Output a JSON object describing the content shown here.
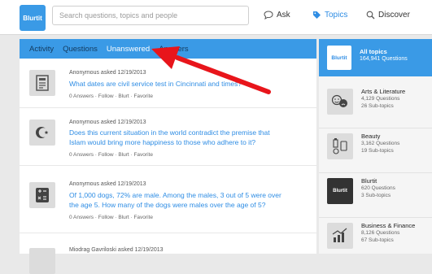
{
  "header": {
    "logo_text": "Blurtit",
    "search_placeholder": "Search questions, topics and people",
    "nav": [
      {
        "label": "Ask",
        "icon": "speech-bubble-icon"
      },
      {
        "label": "Topics",
        "icon": "tag-icon"
      },
      {
        "label": "Discover",
        "icon": "magnifier-icon"
      }
    ]
  },
  "tabs": [
    "Activity",
    "Questions",
    "Unanswered",
    "Answers"
  ],
  "active_tab": "Unanswered",
  "questions": [
    {
      "asker": "Anonymous",
      "asked": "asked 12/19/2013",
      "title_lines": [
        "What dates are civil service test in Cincinnati and times?"
      ],
      "icon": "document-icon",
      "actions": "0 Answers · Follow · Blurt · Favorite"
    },
    {
      "asker": "Anonymous",
      "asked": "asked 12/19/2013",
      "title_lines": [
        "Does this current situation in the world contradict the premise that",
        "Islam would bring more happiness to those who adhere to it?"
      ],
      "icon": "crescent-star-icon",
      "actions": "0 Answers · Follow · Blurt · Favorite"
    },
    {
      "asker": "Anonymous",
      "asked": "asked 12/19/2013",
      "title_lines": [
        "Of 1,000 dogs, 72% are male. Among the males, 3 out of 5 were over",
        "the age 5. How many of the dogs were males over the age of 5?"
      ],
      "icon": "calculator-icon",
      "actions": "0 Answers · Follow · Blurt · Favorite"
    },
    {
      "asker": "Miodrag Gavriloski",
      "asked": "asked 12/19/2013",
      "title_lines": [],
      "icon": "document-icon",
      "actions": ""
    }
  ],
  "sidebar": {
    "all_topics": {
      "title": "All topics",
      "count": "164,941 Questions",
      "thumb": "Blurtit"
    },
    "topics": [
      {
        "name": "Arts & Literature",
        "questions": "4,129 Questions",
        "subtopics": "26 Sub-topics",
        "icon": "theatre-masks-icon"
      },
      {
        "name": "Beauty",
        "questions": "3,162 Questions",
        "subtopics": "19 Sub-topics",
        "icon": "beauty-products-icon"
      },
      {
        "name": "Blurtit",
        "questions": "620 Questions",
        "subtopics": "3 Sub-topics",
        "icon": "blurtit-logo-icon"
      },
      {
        "name": "Business & Finance",
        "questions": "8,126 Questions",
        "subtopics": "67 Sub-topics",
        "icon": "finance-chart-icon"
      }
    ]
  },
  "colors": {
    "accent": "#3a9ae6",
    "link": "#2f8de4",
    "annotation_arrow": "#e8151b"
  }
}
